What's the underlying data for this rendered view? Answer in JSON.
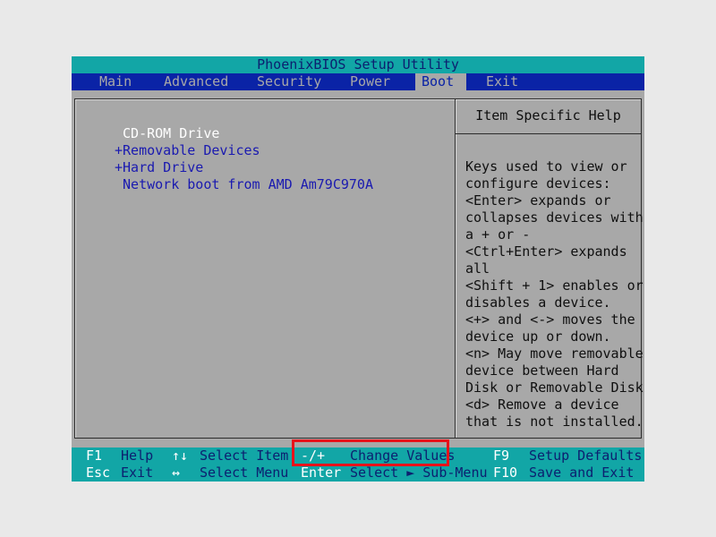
{
  "title": "PhoenixBIOS Setup Utility",
  "menu": {
    "items": [
      {
        "label": "Main"
      },
      {
        "label": "Advanced"
      },
      {
        "label": "Security"
      },
      {
        "label": "Power"
      },
      {
        "label": "Boot"
      },
      {
        "label": "Exit"
      }
    ],
    "active": "Boot"
  },
  "boot_list": [
    {
      "prefix": " ",
      "label": "CD-ROM Drive",
      "selected": true
    },
    {
      "prefix": "+",
      "label": "Removable Devices",
      "selected": false
    },
    {
      "prefix": "+",
      "label": "Hard Drive",
      "selected": false
    },
    {
      "prefix": " ",
      "label": "Network boot from AMD Am79C970A",
      "selected": false
    }
  ],
  "help": {
    "title": "Item Specific Help",
    "lines": [
      "Keys used to view or",
      "configure devices:",
      "<Enter> expands or",
      "collapses devices with",
      "a + or -",
      "<Ctrl+Enter> expands",
      "all",
      "<Shift + 1> enables or",
      "disables a device.",
      "<+> and <-> moves the",
      "device up or down.",
      "<n> May move removable",
      "device between Hard",
      "Disk or Removable Disk",
      "<d> Remove a device",
      "that is not installed."
    ]
  },
  "footer": {
    "row1": {
      "k1": "F1",
      "d1": "Help",
      "a1": "↑↓",
      "d2": "Select Item",
      "k2": "-/+",
      "d3": "Change Values",
      "k3": "F9",
      "d4": "Setup Defaults"
    },
    "row2": {
      "k1": "Esc",
      "d1": "Exit",
      "a1": "↔",
      "d2": "Select Menu",
      "k2": "Enter",
      "d3": "Select ► Sub-Menu",
      "k3": "F10",
      "d4": "Save and Exit"
    }
  },
  "colors": {
    "title_bar": "#12a6a6",
    "menu_bar": "#0a23a6",
    "panel_bg": "#a8a8a8",
    "highlight": "#e8121a"
  }
}
